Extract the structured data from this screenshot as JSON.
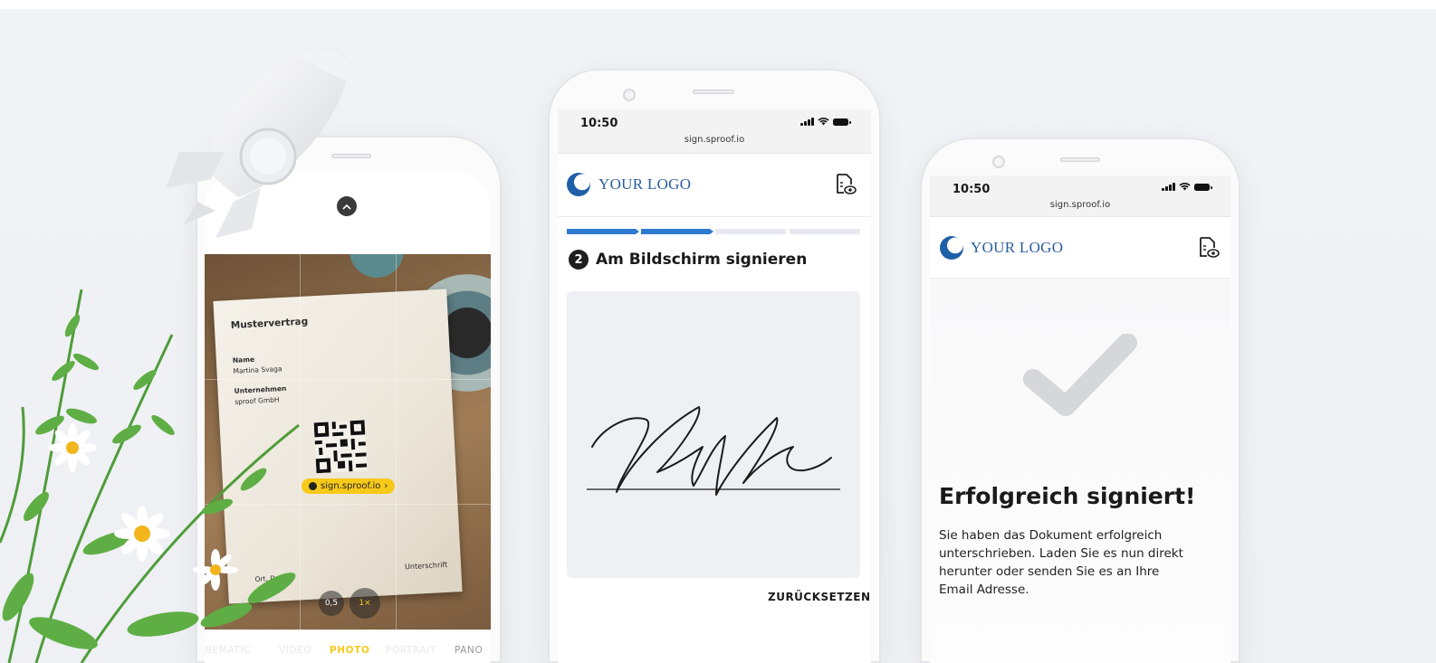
{
  "camera_phone": {
    "document_title": "Mustervertrag",
    "name_label": "Name",
    "name_value": "Martina Svaga",
    "company_label": "Unternehmen",
    "company_value": "sproof GmbH",
    "qr_link": "sign.sproof.io",
    "place_date_label": "Ort, Datum",
    "signature_label": "Unterschrift",
    "zoom_options": [
      "0,5",
      "1×"
    ],
    "modes": [
      "NEMATIC",
      "VIDEO",
      "PHOTO",
      "PORTRAIT",
      "PANO"
    ],
    "active_mode": "PHOTO"
  },
  "sign_phone": {
    "time": "10:50",
    "url": "sign.sproof.io",
    "logo_text": "YOUR LOGO",
    "step_number": "2",
    "step_title": "Am Bildschirm signieren",
    "progress_steps_done": 2,
    "progress_steps_total": 4,
    "reset_label": "ZURÜCKSETZEN"
  },
  "success_phone": {
    "time": "10:50",
    "url": "sign.sproof.io",
    "logo_text": "YOUR LOGO",
    "title": "Erfolgreich signiert!",
    "message": "Sie haben das Dokument erfolgreich unterschrieben. Laden Sie es nun direkt herunter oder senden Sie es an Ihre Email Adresse."
  },
  "colors": {
    "brand_blue": "#1f5fa8",
    "progress_blue": "#2f7ad1",
    "camera_highlight": "#f7c919"
  }
}
